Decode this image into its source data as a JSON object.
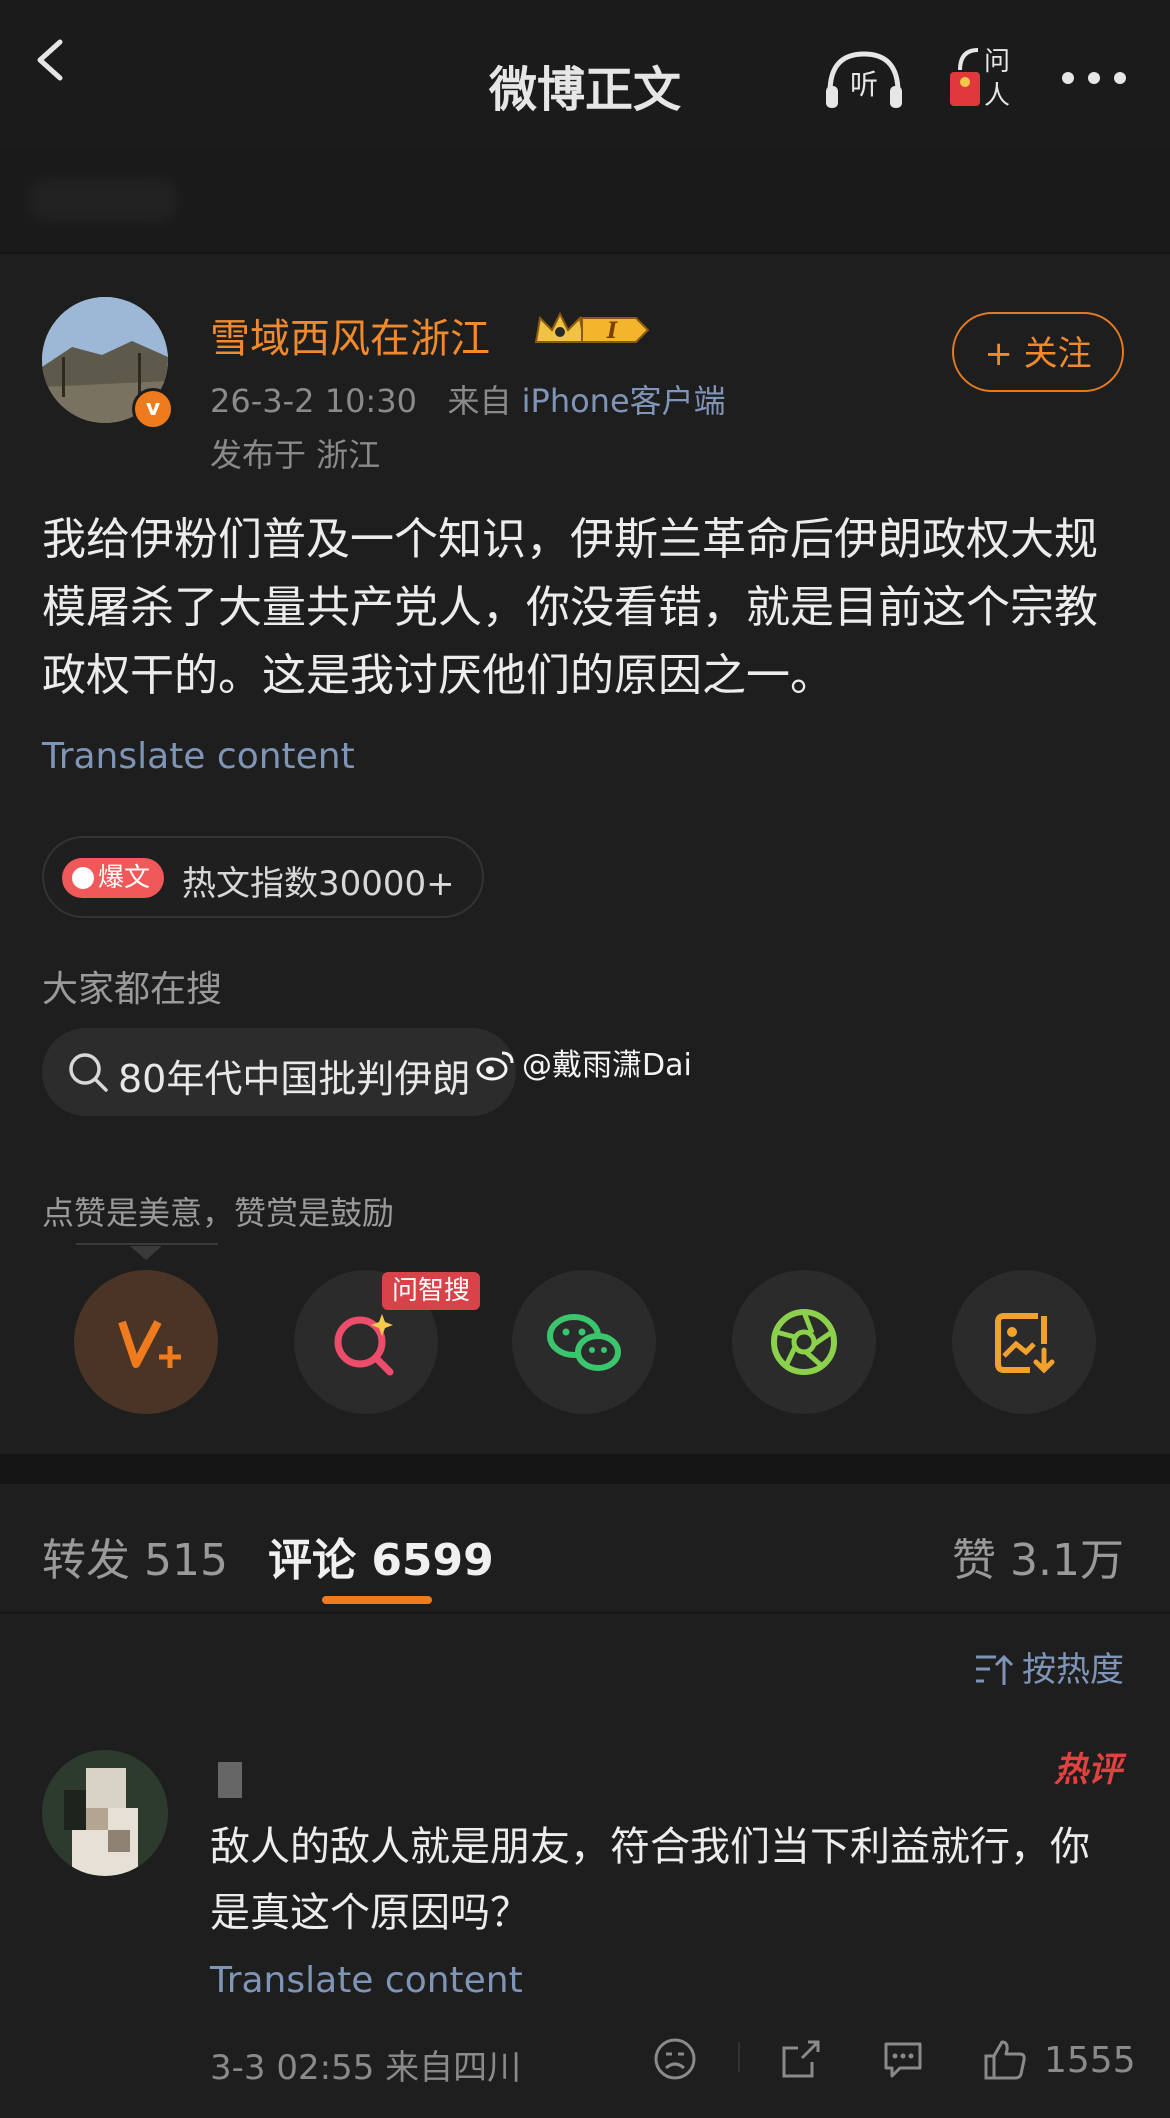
{
  "nav": {
    "title": "微博正文",
    "listen_label": "听",
    "ask_label": "问人"
  },
  "post": {
    "author": "雪域西风在浙江",
    "time": "26-3-2 10:30",
    "source_prefix": "来自",
    "source_device": "iPhone客户端",
    "location": "发布于 浙江",
    "follow_label": "+ 关注",
    "text": "我给伊粉们普及一个知识，伊斯兰革命后伊朗政权大规模屠杀了大量共产党人，你没看错，就是目前这个宗教政权干的。这是我讨厌他们的原因之一。",
    "translate": "Translate content",
    "hot_tag": "爆文",
    "hot_index": "热文指数30000+",
    "search_heading": "大家都在搜",
    "search_text": "80年代中国批判伊朗",
    "watermark": "@戴雨潇Dai",
    "praise_hint": "点赞是美意，赞赏是鼓励",
    "ask_search_tip": "问智搜"
  },
  "tabs": {
    "repost": "转发 515",
    "comment": "评论 6599",
    "like": "赞 3.1万"
  },
  "sort_label": "按热度",
  "comment": {
    "hot_badge": "热评",
    "text": "敌人的敌人就是朋友，符合我们当下利益就行，你是真这个原因吗？",
    "translate": "Translate content",
    "meta": "3-3 02:55  来自四川",
    "likes": "1555"
  },
  "colors": {
    "accent": "#f07b1c",
    "link": "#7f95b8",
    "background": "#1e1e1e"
  }
}
